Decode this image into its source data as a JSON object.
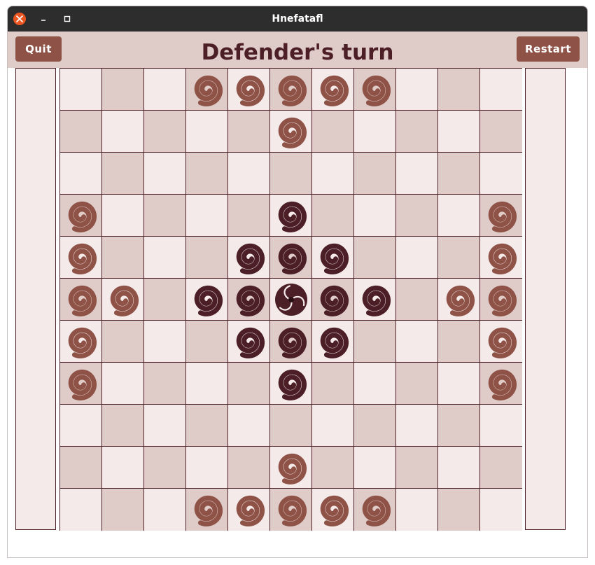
{
  "window": {
    "title": "Hnefatafl"
  },
  "header": {
    "quit_label": "Quit",
    "restart_label": "Restart",
    "turn_text": "Defender's turn"
  },
  "colors": {
    "attacker": "#8e5246",
    "defender": "#4b1f25",
    "king": "#4b1f25",
    "light_cell": "#f4eaea",
    "dark_cell": "#dfcbc7",
    "header_bg": "#dfcbc7",
    "button_bg": "#8e5246"
  },
  "icons": {
    "attacker": "spiral-icon",
    "defender": "spiral-icon",
    "king": "vortex-icon"
  },
  "board": {
    "size": 11,
    "rows": [
      "...AAAAA...",
      ".....A.....",
      "...........",
      "A....D....A",
      "A...DDD...A",
      "AA.DDKDD.AA",
      "A...DDD...A",
      "A....D....A",
      "...........",
      ".....A.....",
      "...AAAAA..."
    ]
  }
}
